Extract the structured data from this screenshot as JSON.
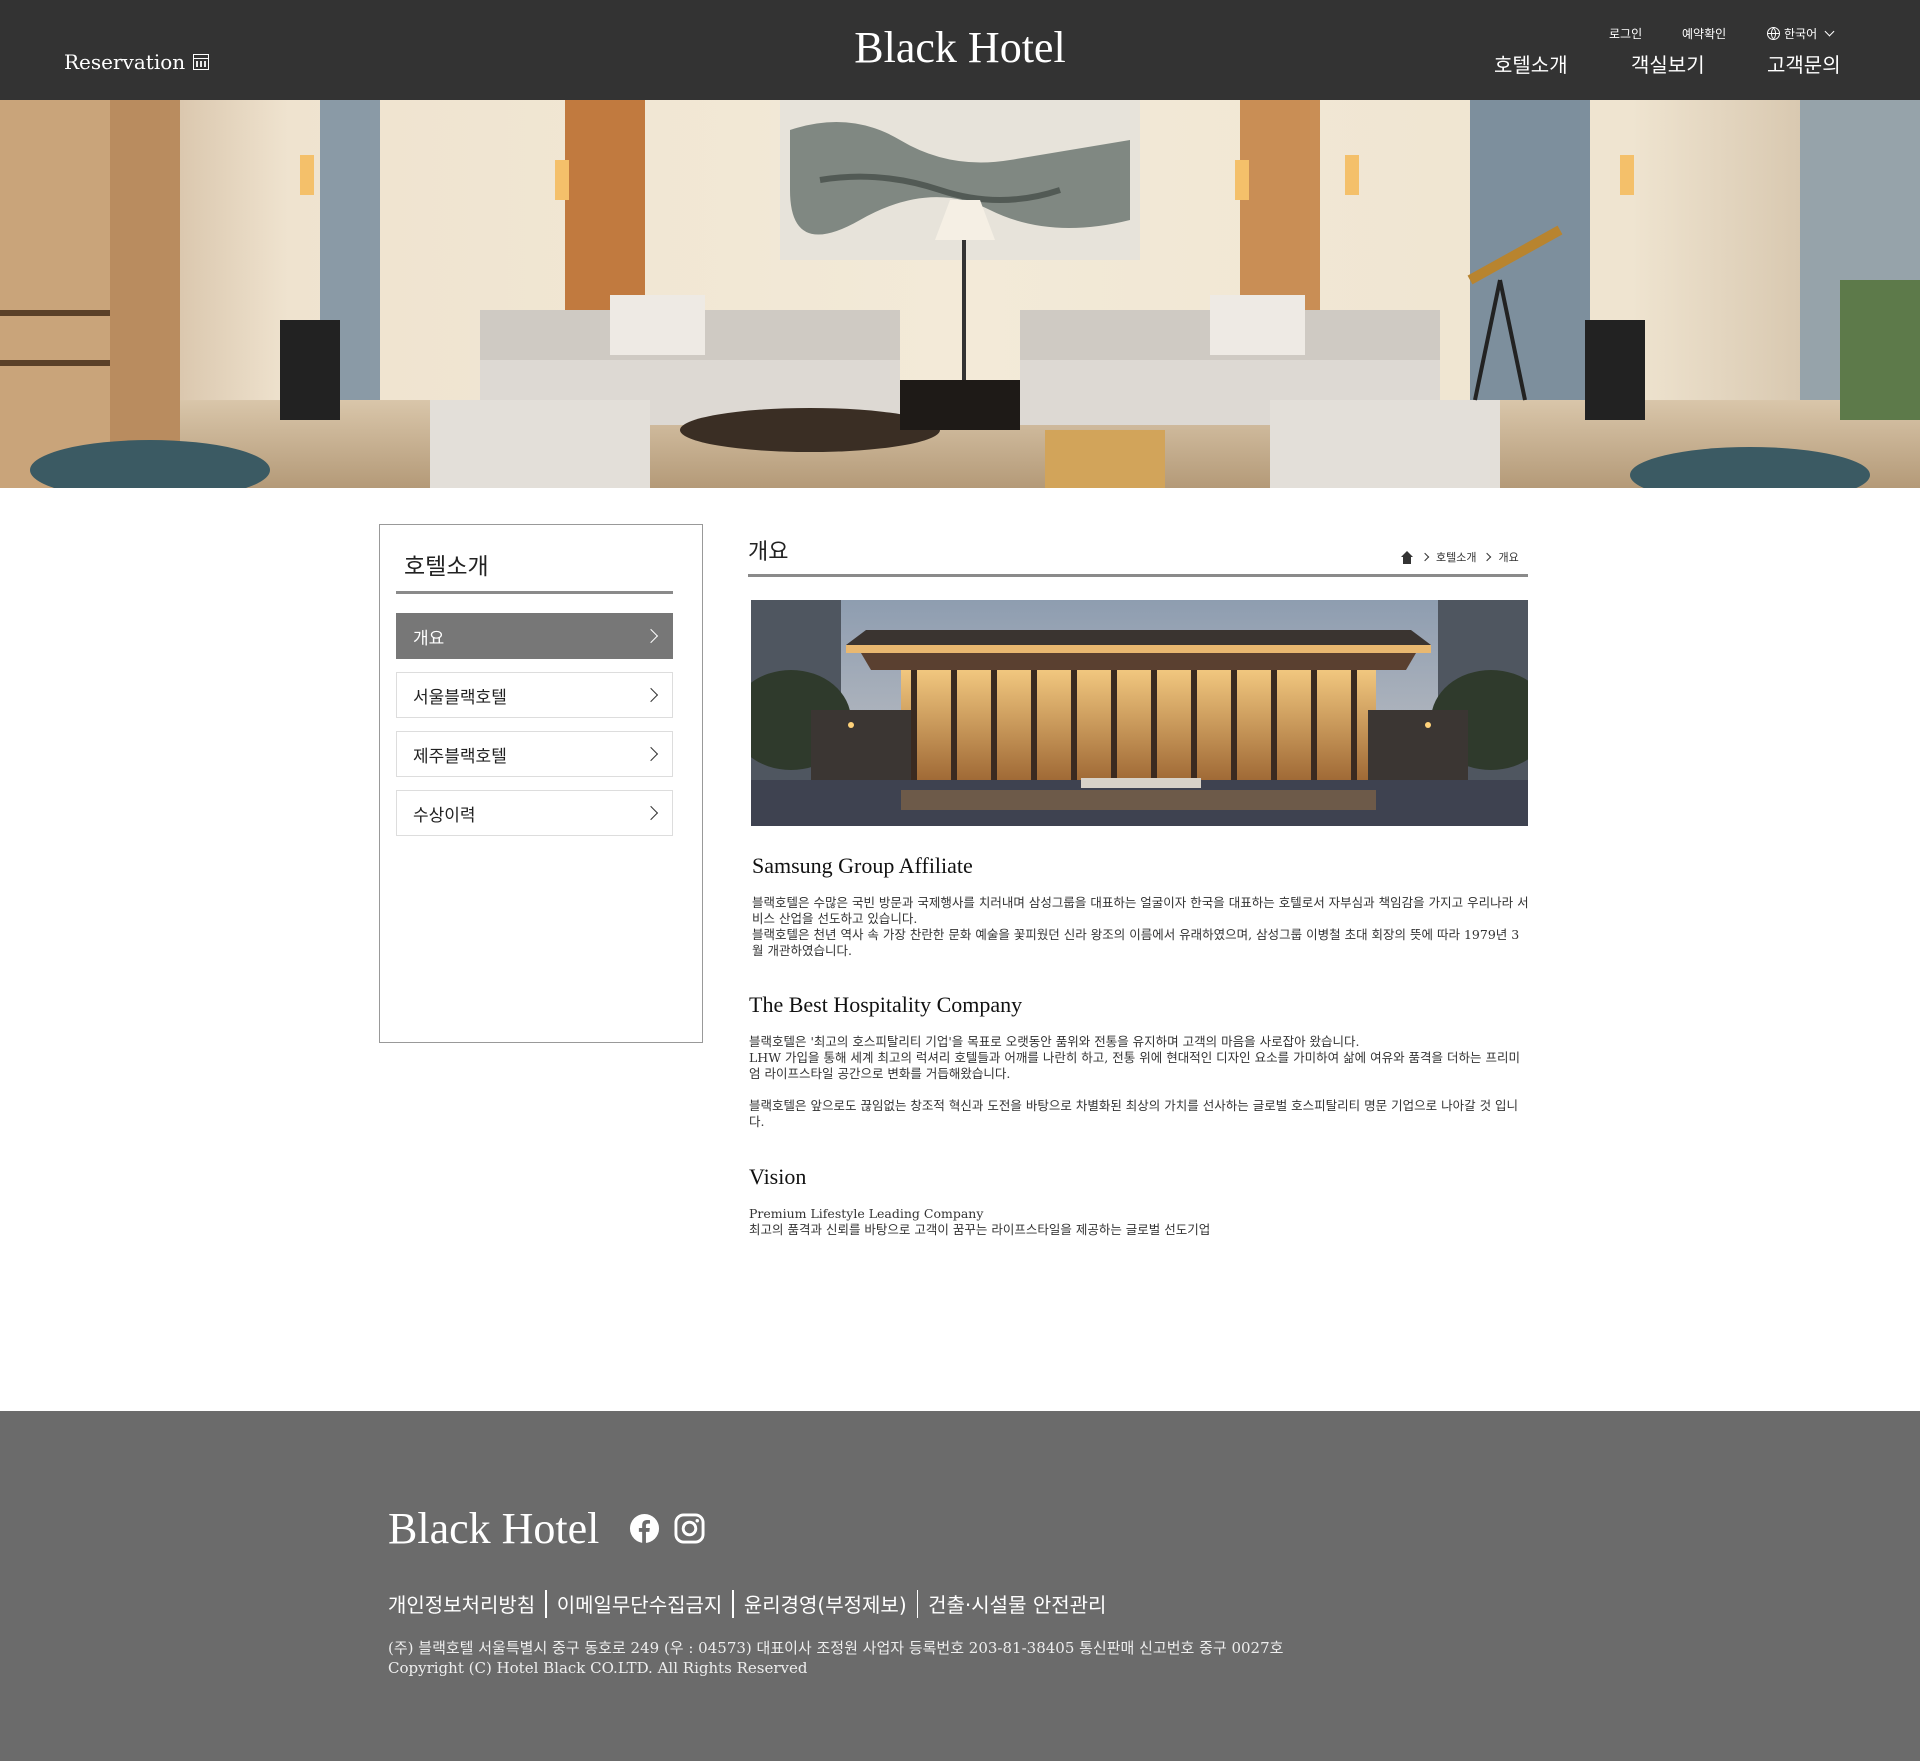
{
  "header": {
    "reservation_label": "Reservation",
    "brand": "Black Hotel",
    "util": {
      "login": "로그인",
      "reservation_check": "예약확인",
      "language": "한국어"
    },
    "nav": [
      "호텔소개",
      "객실보기",
      "고객문의"
    ]
  },
  "sidebar": {
    "title": "호텔소개",
    "items": [
      "개요",
      "서울블랙호텔",
      "제주블랙호텔",
      "수상이력"
    ],
    "active_index": 0
  },
  "main": {
    "page_title": "개요",
    "breadcrumb": [
      "호텔소개",
      "개요"
    ],
    "sections": [
      {
        "title": "Samsung Group Affiliate",
        "paragraphs": [
          "블랙호텔은 수많은 국빈 방문과 국제행사를 치러내며 삼성그룹을 대표하는 얼굴이자 한국을 대표하는 호텔로서 자부심과 책임감을 가지고 우리나라 서비스 산업을 선도하고 있습니다.",
          "블랙호텔은 천년 역사 속 가장 찬란한 문화 예술을 꽃피웠던 신라 왕조의 이름에서 유래하였으며, 삼성그룹 이병철 초대 회장의 뜻에 따라 1979년 3월 개관하였습니다."
        ]
      },
      {
        "title": "The Best Hospitality Company",
        "paragraphs": [
          "블랙호텔은 '최고의 호스피탈리티 기업'을 목표로 오랫동안 품위와 전통을 유지하며 고객의 마음을 사로잡아 왔습니다.",
          "LHW 가입을 통해 세계 최고의 럭셔리 호텔들과 어깨를 나란히 하고, 전통 위에 현대적인 디자인 요소를 가미하여 삶에 여유와 품격을 더하는 프리미엄 라이프스타일 공간으로 변화를 거듭해왔습니다.",
          "블랙호텔은 앞으로도 끊임없는 창조적 혁신과 도전을 바탕으로 차별화된 최상의 가치를 선사하는 글로벌 호스피탈리티 명문 기업으로 나아갈 것 입니다."
        ]
      },
      {
        "title": "Vision",
        "paragraphs": [
          "Premium Lifestyle Leading Company",
          "최고의 품격과 신뢰를 바탕으로 고객이 꿈꾸는 라이프스타일을 제공하는 글로벌 선도기업"
        ]
      }
    ]
  },
  "footer": {
    "brand": "Black Hotel",
    "links": [
      "개인정보처리방침",
      "이메일무단수집금지",
      "윤리경영(부정제보)",
      "건출·시설물 안전관리"
    ],
    "address": "(주) 블랙호텔 서울특별시 중구 동호로 249 (우 : 04573) 대표이사 조정원   사업자 등록번호  203-81-38405 통신판매 신고번호 중구 0027호",
    "copyright": "Copyright (C) Hotel Black CO.LTD. All Rights Reserved"
  },
  "colors": {
    "header_bg": "#333333",
    "footer_bg": "#6b6b6b",
    "active_item_bg": "#777777",
    "rule": "#8a8a8a"
  },
  "icons": [
    "calendar-icon",
    "globe-icon",
    "chevron-down-icon",
    "chevron-right-icon",
    "home-icon",
    "facebook-icon",
    "instagram-icon"
  ]
}
